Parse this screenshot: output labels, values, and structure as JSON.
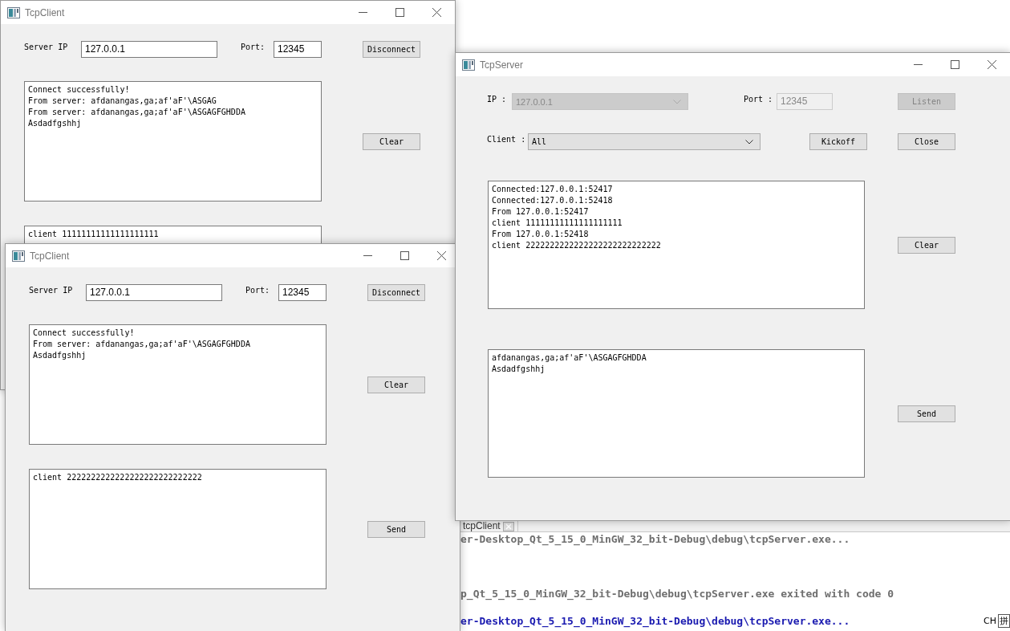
{
  "windows": [
    {
      "kind": "client",
      "title": "TcpClient",
      "server_ip_label": "Server IP",
      "server_ip": "127.0.0.1",
      "port_label": "Port:",
      "port": "12345",
      "connect_button": "Disconnect",
      "log": [
        "Connect successfully!",
        "From server: afdanangas,ga;af'aF'\\ASGAG",
        "From server: afdanangas,ga;af'aF'\\ASGAGFGHDDA",
        "Asdadfgshhj"
      ],
      "clear_button": "Clear",
      "message": [
        "client 11111111111111111111"
      ]
    },
    {
      "kind": "client",
      "title": "TcpClient",
      "server_ip_label": "Server IP",
      "server_ip": "127.0.0.1",
      "port_label": "Port:",
      "port": "12345",
      "connect_button": "Disconnect",
      "log": [
        "Connect successfully!",
        "From server: afdanangas,ga;af'aF'\\ASGAGFGHDDA",
        "Asdadfgshhj"
      ],
      "clear_button": "Clear",
      "message": [
        "client 2222222222222222222222222222"
      ],
      "send_button": "Send"
    },
    {
      "kind": "server",
      "title": "TcpServer",
      "ip_label": "IP :",
      "ip": {
        "value": "127.0.0.1",
        "disabled": true
      },
      "port_label": "Port :",
      "port": {
        "value": "12345",
        "disabled": true
      },
      "listen_button": {
        "label": "Listen",
        "disabled": true
      },
      "client_label": "Client :",
      "client": "All",
      "kickoff_button": "Kickoff",
      "close_button": "Close",
      "log": [
        "Connected:127.0.0.1:52417",
        "Connected:127.0.0.1:52418",
        "From 127.0.0.1:52417",
        "client 11111111111111111111",
        "From 127.0.0.1:52418",
        "client 2222222222222222222222222222"
      ],
      "clear_button": "Clear",
      "message": [
        "afdanangas,ga;af'aF'\\ASGAGFGHDDA",
        "Asdadfgshhj"
      ],
      "send_button": "Send"
    }
  ],
  "console": {
    "tab": "tcpClient",
    "lines": [
      {
        "kind": "start",
        "text": "er-Desktop_Qt_5_15_0_MinGW_32_bit-Debug\\debug\\tcpServer.exe..."
      },
      {
        "kind": "exit",
        "text": "p_Qt_5_15_0_MinGW_32_bit-Debug\\debug\\tcpServer.exe exited with code 0"
      },
      {
        "kind": "restart",
        "text": "er-Desktop_Qt_5_15_0_MinGW_32_bit-Debug\\debug\\tcpServer.exe..."
      }
    ]
  },
  "ime": [
    "CH",
    "拼"
  ]
}
